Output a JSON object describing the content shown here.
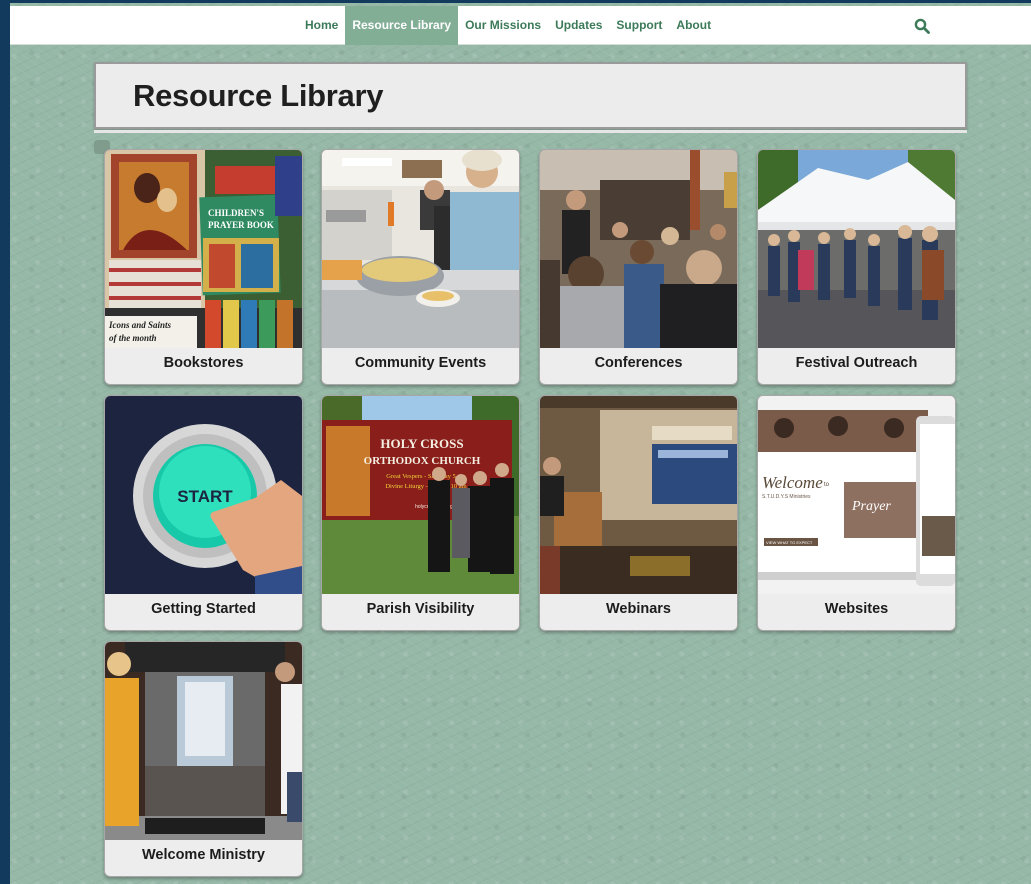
{
  "nav": {
    "items": [
      {
        "label": "Home"
      },
      {
        "label": "Resource Library",
        "active": true
      },
      {
        "label": "Our Missions"
      },
      {
        "label": "Updates"
      },
      {
        "label": "Support"
      },
      {
        "label": "About"
      }
    ],
    "search_icon": "search-icon",
    "active_bg": "#82ae96",
    "link_color": "#3c7a58"
  },
  "page": {
    "title": "Resource Library",
    "background": "#96b8a7"
  },
  "cards": [
    {
      "label": "Bookstores",
      "image_text": [
        "CHILDREN'S",
        "PRAYER BOOK",
        "Icons and Saints",
        "of the month"
      ]
    },
    {
      "label": "Community Events"
    },
    {
      "label": "Conferences"
    },
    {
      "label": "Festival Outreach"
    },
    {
      "label": "Getting Started",
      "image_text": [
        "START"
      ]
    },
    {
      "label": "Parish Visibility",
      "image_text": [
        "HOLY CROSS",
        "ORTHODOX CHURCH",
        "Great Vespers - Saturday 5 pm",
        "Divine Liturgy - Sunday 10 am",
        "holycrossoca.org"
      ]
    },
    {
      "label": "Webinars"
    },
    {
      "label": "Websites",
      "image_text": [
        "Welcome",
        "to",
        "S.T.U.D.Y.S Ministries",
        "Prayer",
        "VIEW WHAT TO EXPECT"
      ]
    },
    {
      "label": "Welcome Ministry"
    }
  ]
}
